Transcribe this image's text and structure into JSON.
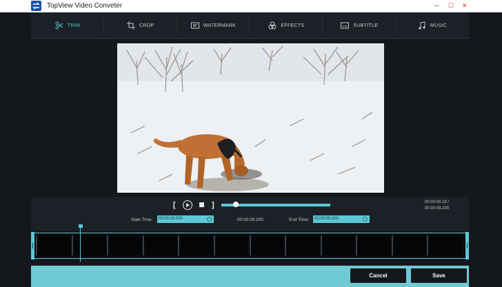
{
  "window": {
    "title": "TopView Video Conveter",
    "minimize_glyph": "─",
    "maximize_glyph": "☐",
    "close_glyph": "✕"
  },
  "tabs": [
    {
      "label": "TRIM",
      "icon": "scissors-icon",
      "active": true
    },
    {
      "label": "CROP",
      "icon": "crop-icon",
      "active": false
    },
    {
      "label": "WATERMARK",
      "icon": "watermark-icon",
      "active": false
    },
    {
      "label": "EFFECTS",
      "icon": "effects-icon",
      "active": false
    },
    {
      "label": "SUBTITLE",
      "icon": "subtitle-icon",
      "active": false
    },
    {
      "label": "MUSIC",
      "icon": "music-icon",
      "active": false
    }
  ],
  "player": {
    "open_bracket": "[",
    "close_bracket": "]",
    "progress_fraction": 0.13,
    "current_time": "00:00:00.19 /",
    "total_time": "00:00:09.200"
  },
  "trim": {
    "start_label": "Start Time:",
    "start_value": "00:00:00.000",
    "duration": "00:00:09.200",
    "end_label": "End Time:",
    "end_value": "00:00:09.200"
  },
  "timeline": {
    "frame_count": 12,
    "playhead_fraction": 0.11
  },
  "footer": {
    "cancel_label": "Cancel",
    "save_label": "Save"
  },
  "colors": {
    "accent": "#5cc8d6",
    "background": "#14181d",
    "toolbar": "#1c2127",
    "footer": "#6fcad4"
  }
}
